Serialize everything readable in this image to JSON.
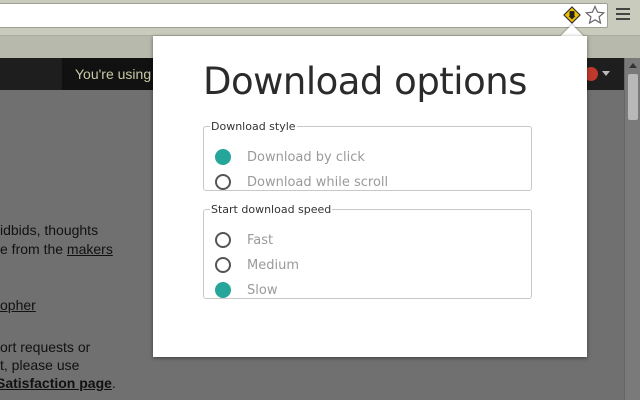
{
  "browser": {
    "extension_icon": "download-extension-icon",
    "star_icon": "star-icon",
    "menu_icon": "hamburger-menu-icon"
  },
  "page": {
    "notice_text": "You're using",
    "lines": [
      {
        "text": "idbids, thoughts"
      },
      {
        "text": "e from the ",
        "link": "makers"
      },
      {
        "link": "opher"
      },
      {
        "text": "ort requests or"
      },
      {
        "text": "t, please use"
      },
      {
        "bold_link": "Satisfaction page",
        "text_after": "."
      }
    ]
  },
  "popup": {
    "title": "Download options",
    "download_style": {
      "legend": "Download style",
      "options": [
        {
          "label": "Download by click",
          "checked": true
        },
        {
          "label": "Download while scroll",
          "checked": false
        }
      ]
    },
    "download_speed": {
      "legend": "Start download speed",
      "options": [
        {
          "label": "Fast",
          "checked": false
        },
        {
          "label": "Medium",
          "checked": false
        },
        {
          "label": "Slow",
          "checked": true
        }
      ]
    }
  },
  "colors": {
    "accent": "#26a69a",
    "overlay_page": "#707070",
    "chrome": "#c9ccbd"
  }
}
